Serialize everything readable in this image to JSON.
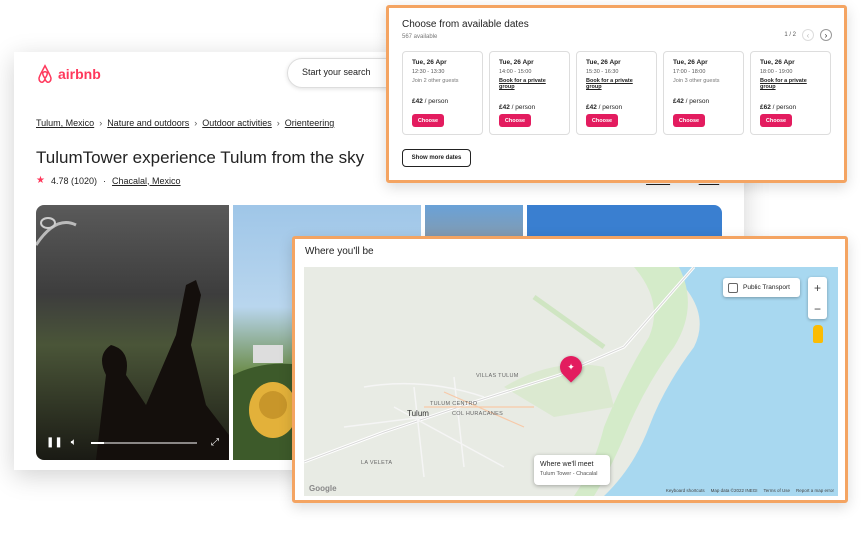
{
  "header": {
    "logo_text": "airbnb",
    "search_placeholder": "Start your search"
  },
  "breadcrumb": [
    "Tulum, Mexico",
    "Nature and outdoors",
    "Outdoor activities",
    "Orienteering"
  ],
  "listing": {
    "title": "TulumTower experience Tulum from the sky",
    "rating": "4.78",
    "reviews": "(1020)",
    "location": "Chacalal, Mexico",
    "share_label": "Share",
    "save_label": "Save"
  },
  "video": {
    "progress": 0.12
  },
  "dates": {
    "title": "Choose from available dates",
    "subtitle": "567 available",
    "pager": "1 / 2",
    "show_more": "Show more dates",
    "choose_label": "Choose",
    "items": [
      {
        "day": "Tue, 26 Apr",
        "time": "12:30 - 13:30",
        "note": "Join 2 other guests",
        "private": false,
        "price": "£42",
        "unit": "/ person"
      },
      {
        "day": "Tue, 26 Apr",
        "time": "14:00 - 15:00",
        "note": "Book for a private group",
        "private": true,
        "price": "£42",
        "unit": "/ person"
      },
      {
        "day": "Tue, 26 Apr",
        "time": "15:30 - 16:30",
        "note": "Book for a private group",
        "private": true,
        "price": "£42",
        "unit": "/ person"
      },
      {
        "day": "Tue, 26 Apr",
        "time": "17:00 - 18:00",
        "note": "Join 3 other guests",
        "private": false,
        "price": "£42",
        "unit": "/ person"
      },
      {
        "day": "Tue, 26 Apr",
        "time": "18:00 - 19:00",
        "note": "Book for a private group",
        "private": true,
        "price": "£62",
        "unit": "/ person"
      }
    ]
  },
  "map": {
    "title": "Where you'll be",
    "public_transport": "Public Transport",
    "zoom_in": "+",
    "zoom_out": "−",
    "labels": {
      "villas": "VILLAS TULUM",
      "tulum": "Tulum",
      "centro": "TULUM CENTRO",
      "huracanes": "COL HURACANES",
      "veleta": "LA VELETA"
    },
    "meet_title": "Where we'll meet",
    "meet_place": "Tulum Tower - Chacalal",
    "google": "Google",
    "attribution": [
      "Keyboard shortcuts",
      "Map data ©2022 INEGI",
      "Terms of Use",
      "Report a map error"
    ]
  }
}
